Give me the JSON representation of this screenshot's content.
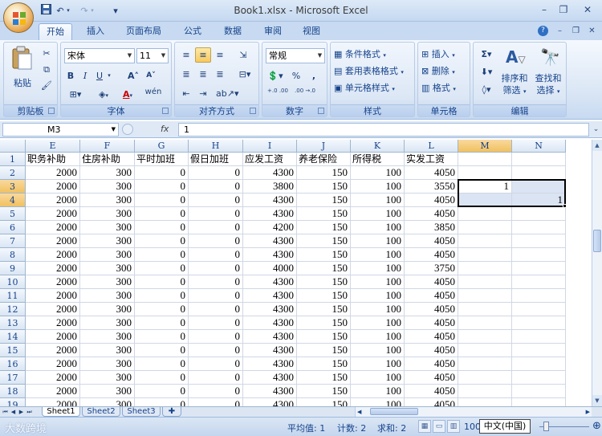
{
  "window": {
    "title": "Book1.xlsx - Microsoft Excel",
    "minimize": "–",
    "restore": "❐",
    "close": "✕"
  },
  "qat": {
    "save_icon": "save-icon",
    "undo": "↶",
    "redo": "↷",
    "customize": "▾"
  },
  "tabs": [
    "开始",
    "插入",
    "页面布局",
    "公式",
    "数据",
    "审阅",
    "视图"
  ],
  "active_tab": "开始",
  "ribbon": {
    "clipboard": {
      "label": "剪贴板",
      "paste": "粘贴"
    },
    "font": {
      "label": "字体",
      "font_name": "宋体",
      "font_size": "11",
      "bold": "B",
      "italic": "I",
      "underline": "U",
      "grow": "A˄",
      "shrink": "A˅",
      "fontcolor": "A",
      "phonetic": "wén"
    },
    "alignment": {
      "label": "对齐方式"
    },
    "number": {
      "label": "数字",
      "format": "常规",
      "percent": "%",
      "comma": ",",
      "inc_decimal": "+.0 .00",
      "dec_decimal": ".00 →.0"
    },
    "styles": {
      "label": "样式",
      "conditional": "条件格式",
      "table": "套用表格格式",
      "cell": "单元格样式"
    },
    "cells": {
      "label": "单元格",
      "insert": "插入",
      "delete": "删除",
      "format": "格式"
    },
    "editing": {
      "label": "编辑",
      "sort": "排序和",
      "filter": "筛选",
      "find": "查找和",
      "select": "选择"
    }
  },
  "formula_bar": {
    "name_box": "M3",
    "fx": "fx",
    "content": "1"
  },
  "columns": [
    "E",
    "F",
    "G",
    "H",
    "I",
    "J",
    "K",
    "L",
    "M",
    "N"
  ],
  "header_row": [
    "职务补助",
    "住房补助",
    "平时加班",
    "假日加班",
    "应发工资",
    "养老保险",
    "所得税",
    "实发工资",
    "",
    ""
  ],
  "rows": [
    [
      "2000",
      "300",
      "0",
      "0",
      "4300",
      "150",
      "100",
      "4050",
      "",
      ""
    ],
    [
      "2000",
      "300",
      "0",
      "0",
      "3800",
      "150",
      "100",
      "3550",
      "1",
      ""
    ],
    [
      "2000",
      "300",
      "0",
      "0",
      "4300",
      "150",
      "100",
      "4050",
      "",
      "1"
    ],
    [
      "2000",
      "300",
      "0",
      "0",
      "4300",
      "150",
      "100",
      "4050",
      "",
      ""
    ],
    [
      "2000",
      "300",
      "0",
      "0",
      "4200",
      "150",
      "100",
      "3850",
      "",
      ""
    ],
    [
      "2000",
      "300",
      "0",
      "0",
      "4300",
      "150",
      "100",
      "4050",
      "",
      ""
    ],
    [
      "2000",
      "300",
      "0",
      "0",
      "4300",
      "150",
      "100",
      "4050",
      "",
      ""
    ],
    [
      "2000",
      "300",
      "0",
      "0",
      "4000",
      "150",
      "100",
      "3750",
      "",
      ""
    ],
    [
      "2000",
      "300",
      "0",
      "0",
      "4300",
      "150",
      "100",
      "4050",
      "",
      ""
    ],
    [
      "2000",
      "300",
      "0",
      "0",
      "4300",
      "150",
      "100",
      "4050",
      "",
      ""
    ],
    [
      "2000",
      "300",
      "0",
      "0",
      "4300",
      "150",
      "100",
      "4050",
      "",
      ""
    ],
    [
      "2000",
      "300",
      "0",
      "0",
      "4300",
      "150",
      "100",
      "4050",
      "",
      ""
    ],
    [
      "2000",
      "300",
      "0",
      "0",
      "4300",
      "150",
      "100",
      "4050",
      "",
      ""
    ],
    [
      "2000",
      "300",
      "0",
      "0",
      "4300",
      "150",
      "100",
      "4050",
      "",
      ""
    ],
    [
      "2000",
      "300",
      "0",
      "0",
      "4300",
      "150",
      "100",
      "4050",
      "",
      ""
    ],
    [
      "2000",
      "300",
      "0",
      "0",
      "4300",
      "150",
      "100",
      "4050",
      "",
      ""
    ],
    [
      "2000",
      "300",
      "0",
      "0",
      "4300",
      "150",
      "100",
      "4050",
      "",
      ""
    ],
    [
      "2000",
      "300",
      "0",
      "0",
      "4300",
      "150",
      "100",
      "4050",
      "",
      ""
    ]
  ],
  "row_numbers": [
    "1",
    "2",
    "3",
    "4",
    "5",
    "6",
    "7",
    "8",
    "9",
    "10",
    "11",
    "12",
    "13",
    "14",
    "15",
    "16",
    "17",
    "18",
    "19"
  ],
  "sheets": [
    "Sheet1",
    "Sheet2",
    "Sheet3"
  ],
  "active_sheet": "Sheet1",
  "status": {
    "watermark": "大数跨境",
    "average": "平均值: 1",
    "count": "计数: 2",
    "sum": "求和: 2",
    "zoom": "100",
    "ime": "中文(中国)"
  }
}
